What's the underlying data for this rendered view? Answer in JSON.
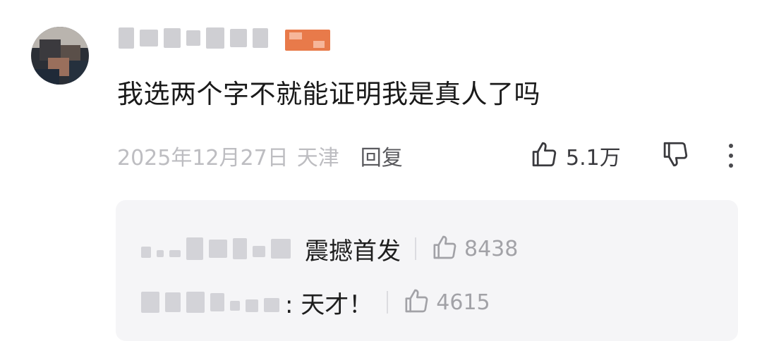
{
  "comment": {
    "text": "我选两个字不就能证明我是真人了吗",
    "date": "2025年12月27日",
    "location": "天津",
    "reply_label": "回复",
    "like_count": "5.1万"
  },
  "replies": [
    {
      "text": "震撼首发",
      "like_count": "8438"
    },
    {
      "text": ": 天才！",
      "like_count": "4615"
    }
  ],
  "icons": {
    "like": "thumbs-up-icon",
    "dislike": "thumbs-down-icon",
    "more": "vertical-ellipsis-icon"
  },
  "colors": {
    "level_badge": "#e87a4a",
    "reply_background": "#f5f5f7",
    "meta_text": "#bdbdc1"
  }
}
